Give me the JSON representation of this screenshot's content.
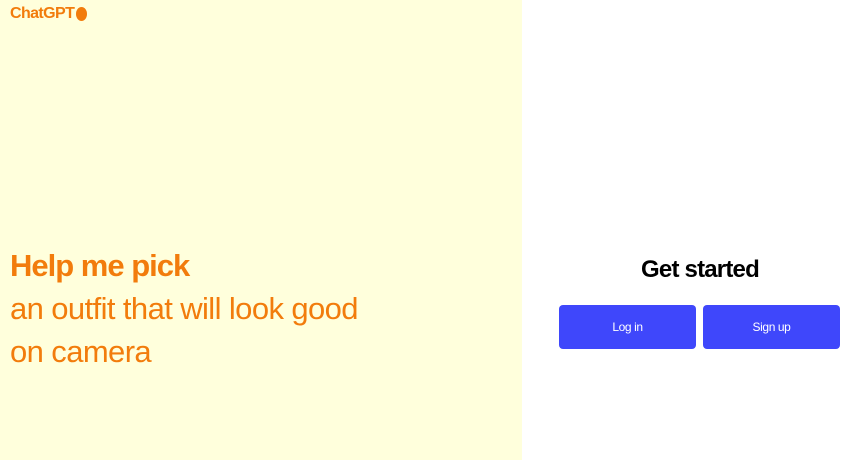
{
  "brand": {
    "name": "ChatGPT",
    "color": "#f27c0c",
    "dot_icon": "circle-icon"
  },
  "hero": {
    "heading": "Help me pick",
    "text": "an outfit that will look good on camera",
    "color": "#f27c0c",
    "background": "#ffffdc"
  },
  "auth": {
    "title": "Get started",
    "login_label": "Log in",
    "signup_label": "Sign up",
    "button_color": "#3f47fb"
  }
}
